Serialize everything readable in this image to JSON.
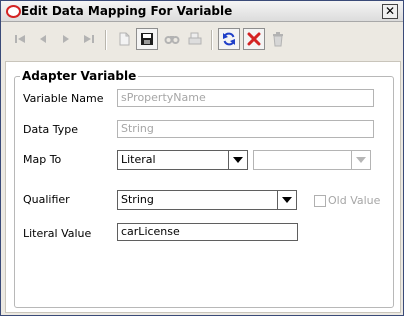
{
  "window": {
    "title": "Edit Data Mapping For Variable",
    "close_glyph": "✕"
  },
  "toolbar": {
    "buttons": [
      {
        "name": "first-record-icon",
        "enabled": false
      },
      {
        "name": "previous-record-icon",
        "enabled": false
      },
      {
        "name": "next-record-icon",
        "enabled": false
      },
      {
        "name": "last-record-icon",
        "enabled": false
      },
      {
        "name": "new-document-icon",
        "enabled": false
      },
      {
        "name": "save-icon",
        "enabled": true
      },
      {
        "name": "find-icon",
        "enabled": false
      },
      {
        "name": "print-icon",
        "enabled": false
      },
      {
        "name": "refresh-icon",
        "enabled": true
      },
      {
        "name": "delete-x-icon",
        "enabled": true
      },
      {
        "name": "trash-icon",
        "enabled": false
      }
    ]
  },
  "adapter_variable": {
    "title": "Adapter Variable",
    "variable_name": {
      "label": "Variable Name",
      "value": "sPropertyName"
    },
    "data_type": {
      "label": "Data Type",
      "value": "String"
    },
    "map_to": {
      "label": "Map To",
      "value": "Literal",
      "secondary_value": ""
    },
    "qualifier": {
      "label": "Qualifier",
      "value": "String"
    },
    "old_value": {
      "label": "Old Value",
      "checked": false
    },
    "literal_value": {
      "label": "Literal Value",
      "value": "carLicense"
    }
  },
  "colors": {
    "accent_red": "#d42323",
    "disabled_text": "#a6a6a6",
    "refresh_blue": "#1f3fc8"
  }
}
